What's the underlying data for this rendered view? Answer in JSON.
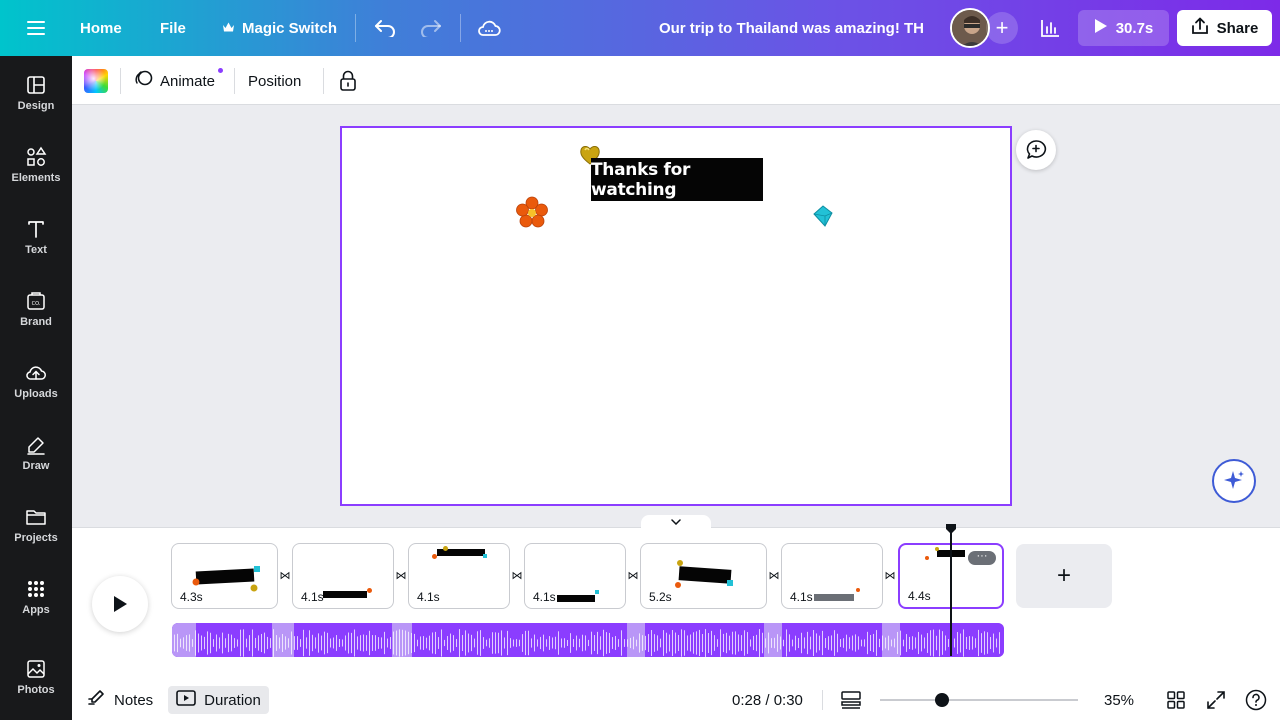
{
  "topbar": {
    "home": "Home",
    "file": "File",
    "magic_switch": "Magic Switch",
    "title": "Our trip to Thailand was amazing! TH",
    "play_duration": "30.7s",
    "share": "Share"
  },
  "sidebar": {
    "items": [
      {
        "label": "Design",
        "icon": "design-icon"
      },
      {
        "label": "Elements",
        "icon": "elements-icon"
      },
      {
        "label": "Text",
        "icon": "text-icon"
      },
      {
        "label": "Brand",
        "icon": "brand-icon"
      },
      {
        "label": "Uploads",
        "icon": "uploads-icon"
      },
      {
        "label": "Draw",
        "icon": "draw-icon"
      },
      {
        "label": "Projects",
        "icon": "projects-icon"
      },
      {
        "label": "Apps",
        "icon": "apps-icon"
      },
      {
        "label": "Photos",
        "icon": "photos-icon"
      }
    ]
  },
  "toolbar": {
    "animate": "Animate",
    "position": "Position"
  },
  "canvas": {
    "text": "Thanks for watching"
  },
  "timeline": {
    "clips": [
      {
        "duration": "4.3s"
      },
      {
        "duration": "4.1s"
      },
      {
        "duration": "4.1s"
      },
      {
        "duration": "4.1s"
      },
      {
        "duration": "5.2s"
      },
      {
        "duration": "4.1s"
      },
      {
        "duration": "4.4s"
      }
    ],
    "add": "+"
  },
  "footer": {
    "notes": "Notes",
    "duration": "Duration",
    "time": "0:28 / 0:30",
    "zoom": "35%"
  },
  "colors": {
    "accent": "#8b3dff",
    "sidebar_bg": "#18191b",
    "canvas_bg": "#ebecf0"
  }
}
